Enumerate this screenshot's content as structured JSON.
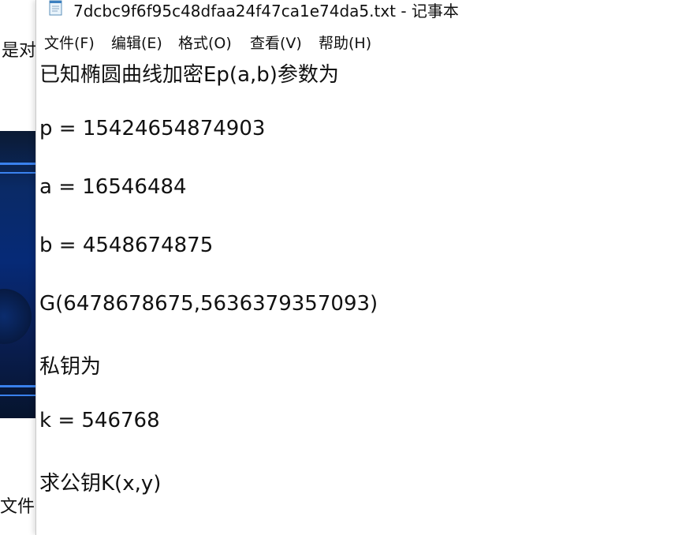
{
  "background_window": {
    "text_top": "是对",
    "text_bottom": "文件↩"
  },
  "notepad": {
    "title": "7dcbc9f6f95c48dfaa24f47ca1e74da5.txt - 记事本",
    "icon": "notepad-file-icon",
    "menu": [
      {
        "label": "文件(F)"
      },
      {
        "label": "编辑(E)"
      },
      {
        "label": "格式(O)"
      },
      {
        "label": "查看(V)"
      },
      {
        "label": "帮助(H)"
      }
    ],
    "content_lines": [
      "已知椭圆曲线加密Ep(a,b)参数为",
      "p = 15424654874903",
      "a = 16546484",
      "b = 4548674875",
      "G(6478678675,5636379357093)",
      "私钥为",
      "k = 546768",
      "求公钥K(x,y)"
    ]
  },
  "colors": {
    "text": "#111111",
    "window_bg": "#ffffff",
    "bg_image_blue": "#062a77",
    "bg_stripe": "#3f8cff"
  }
}
